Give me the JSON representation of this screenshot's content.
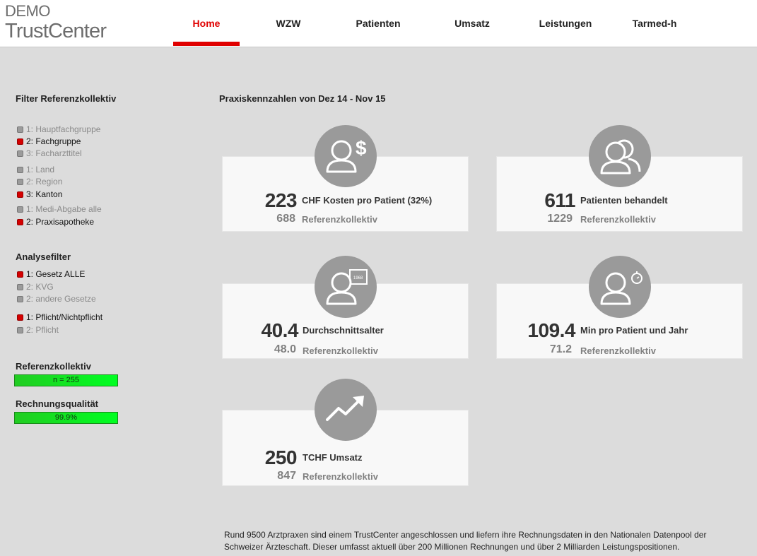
{
  "logo": {
    "line1": "DEMO",
    "line2": "TrustCenter"
  },
  "nav": {
    "items": [
      {
        "label": "Home",
        "active": true
      },
      {
        "label": "WZW",
        "active": false
      },
      {
        "label": "Patienten",
        "active": false
      },
      {
        "label": "Umsatz",
        "active": false
      },
      {
        "label": "Leistungen",
        "active": false
      },
      {
        "label": "Tarmed-h",
        "active": false
      }
    ],
    "accent_color": "#e00000"
  },
  "sidebar": {
    "filter_title": "Filter Referenzkollektiv",
    "filter_options": [
      {
        "label": "1: Hauptfachgruppe",
        "selected": false
      },
      {
        "label": "2: Fachgruppe",
        "selected": true
      },
      {
        "label": "3: Facharzttitel",
        "selected": false
      },
      {
        "label": "1: Land",
        "selected": false
      },
      {
        "label": "2: Region",
        "selected": false
      },
      {
        "label": "3: Kanton",
        "selected": true
      },
      {
        "label": "1: Medi-Abgabe alle",
        "selected": false
      },
      {
        "label": "2: Praxisapotheke",
        "selected": true
      }
    ],
    "analysis_title": "Analysefilter",
    "analysis_options": [
      {
        "label": "1: Gesetz ALLE",
        "selected": true
      },
      {
        "label": "2: KVG",
        "selected": false
      },
      {
        "label": "2: andere Gesetze",
        "selected": false
      },
      {
        "label": "1: Pflicht/Nichtpflicht",
        "selected": true
      },
      {
        "label": "2: Pflicht",
        "selected": false
      }
    ],
    "reference_title": "Referenzkollektiv",
    "reference_value": "n = 255",
    "quality_title": "Rechnungsqualität",
    "quality_value": "99.9%",
    "bar_color": "#00ff22"
  },
  "main": {
    "title": "Praxiskennzahlen von Dez 14 - Nov 15",
    "cards": [
      {
        "icon": "patient-cost-icon",
        "value": "223",
        "label": "CHF Kosten pro Patient (32%)",
        "ref_value": "688",
        "ref_label": "Referenzkollektiv"
      },
      {
        "icon": "patients-icon",
        "value": "611",
        "label": "Patienten behandelt",
        "ref_value": "1229",
        "ref_label": "Referenzkollektiv"
      },
      {
        "icon": "patient-age-icon",
        "value": "40.4",
        "label": "Durchschnittsalter",
        "ref_value": "48.0",
        "ref_label": "Referenzkollektiv"
      },
      {
        "icon": "patient-time-icon",
        "value": "109.4",
        "label": "Min pro Patient und Jahr",
        "ref_value": "71.2",
        "ref_label": "Referenzkollektiv"
      },
      {
        "icon": "trend-up-icon",
        "value": "250",
        "label": "TCHF Umsatz",
        "ref_value": "847",
        "ref_label": "Referenzkollektiv"
      }
    ]
  },
  "footer": {
    "text": "Rund 9500 Arztpraxen sind einem TrustCenter angeschlossen und liefern ihre Rechnungsdaten in den Nationalen Datenpool der Schweizer Ärzteschaft. Dieser umfasst aktuell über 200 Millionen Rechnungen und über 2 Milliarden Leistungspositionen."
  }
}
